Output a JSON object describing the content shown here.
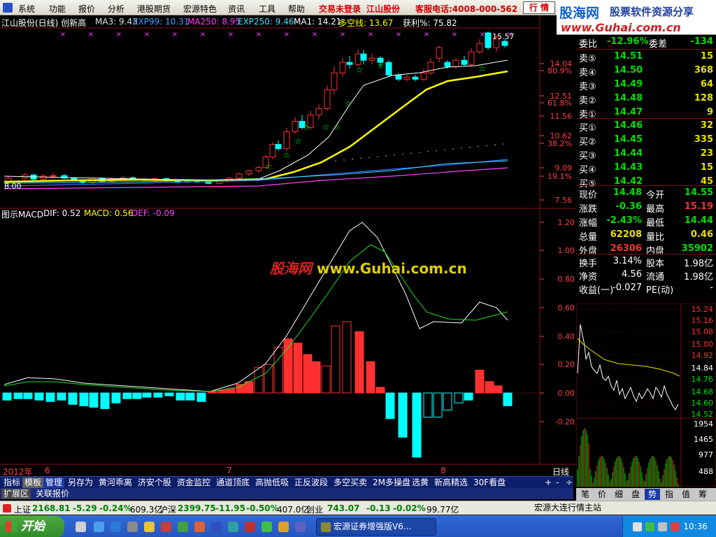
{
  "menu": {
    "items": [
      "系统",
      "功能",
      "报价",
      "分析",
      "港股期货",
      "宏源特色",
      "资讯",
      "工具",
      "帮助"
    ],
    "login_status": "交易未登录",
    "stock_name": "江山股份",
    "hotline": "客服电话:4008-000-562",
    "quote_btn": "行 情"
  },
  "logo": {
    "brand": "股海网",
    "slogan": "股票软件资源分享",
    "url": "www.Guhai.com.cn"
  },
  "kline_info": {
    "title": "江山股份(日线) 创新高",
    "ma3": "MA3: 9.43",
    "exp99": "EXP99: 10.31",
    "ma250": "MA250: 8.95",
    "exp250": "EXP250: 9.46",
    "ma1": "MA1: 14.21",
    "dkx": "多空线: 13.67",
    "profit": "获利%: 75.82"
  },
  "price_axis": [
    "14.04",
    "80.9%",
    "12.51",
    "61.8%",
    "11.56",
    "10.62",
    "38.2%",
    "9.09",
    "19.1%",
    "7.56"
  ],
  "kline_labels": {
    "high_mark": "15.57",
    "low_mark": "8.00"
  },
  "macd_info": {
    "title": "图示MACD",
    "dif": "DIF: 0.52",
    "macd": "MACD: 0.56",
    "def": "DEF: -0.09"
  },
  "macd_axis": [
    "1.20",
    "1.00",
    "0.80",
    "0.60",
    "0.40",
    "0.20",
    "0.00",
    "-0.20"
  ],
  "watermark": {
    "cn": "股海网",
    "url": "www.Guhai.com.cn"
  },
  "period_bar": {
    "year": "2012年",
    "m6": "6",
    "m7": "7",
    "m8": "8",
    "cycle": "日线"
  },
  "tabs1": [
    "指标",
    "模板",
    "管理",
    "另存为",
    "黄河乖离",
    "济安个股",
    "资金监控",
    "通道顶底",
    "高抛低吸",
    "正反波段",
    "多空买卖",
    "2M多操盘",
    "选黄",
    "新高精选",
    "30F看盘"
  ],
  "tabs2": [
    "扩展区",
    "关联报价"
  ],
  "zoom": [
    "+",
    "-",
    "÷"
  ],
  "right_tabs": [
    "笔",
    "价",
    "细",
    "盘",
    "势",
    "指",
    "值",
    "筹"
  ],
  "order_book": {
    "wb_label": "委比",
    "wb": "-12.96%",
    "wc_label": "委差",
    "wc": "-134",
    "asks": [
      {
        "label": "卖⑤",
        "price": "14.51",
        "vol": "15"
      },
      {
        "label": "卖④",
        "price": "14.50",
        "vol": "368"
      },
      {
        "label": "卖③",
        "price": "14.49",
        "vol": "64"
      },
      {
        "label": "卖②",
        "price": "14.48",
        "vol": "128"
      },
      {
        "label": "卖①",
        "price": "14.47",
        "vol": "9"
      }
    ],
    "bids": [
      {
        "label": "买①",
        "price": "14.46",
        "vol": "32"
      },
      {
        "label": "买②",
        "price": "14.45",
        "vol": "335"
      },
      {
        "label": "买③",
        "price": "14.44",
        "vol": "23"
      },
      {
        "label": "买④",
        "price": "14.43",
        "vol": "15"
      },
      {
        "label": "买⑤",
        "price": "14.42",
        "vol": "45"
      }
    ]
  },
  "quote": [
    {
      "l1": "现价",
      "v1": "14.48",
      "l2": "今开",
      "v2": "14.55",
      "c1": "#00e000",
      "c2": "#00e000"
    },
    {
      "l1": "涨跌",
      "v1": "-0.36",
      "l2": "最高",
      "v2": "15.19",
      "c1": "#00e000",
      "c2": "#ff3030"
    },
    {
      "l1": "涨幅",
      "v1": "-2.43%",
      "l2": "最低",
      "v2": "14.44",
      "c1": "#00e000",
      "c2": "#00e000"
    },
    {
      "l1": "总量",
      "v1": "62208",
      "l2": "量比",
      "v2": "0.46",
      "c1": "#e8e000",
      "c2": "#e8e000"
    },
    {
      "l1": "外盘",
      "v1": "26306",
      "l2": "内盘",
      "v2": "35902",
      "c1": "#ff3030",
      "c2": "#00e000"
    }
  ],
  "fund": [
    {
      "l1": "换手",
      "v1": "3.14%",
      "l2": "股本",
      "v2": "1.98亿"
    },
    {
      "l1": "净资",
      "v1": "4.56",
      "l2": "流通",
      "v2": "1.98亿"
    },
    {
      "l1": "收益(一)",
      "v1": "-0.027",
      "l2": "PE(动)",
      "v2": "-"
    }
  ],
  "intraday_axis": [
    "15.24",
    "15.16",
    "15.08",
    "15.00",
    "14.92",
    "14.84",
    "14.76",
    "14.68",
    "14.60",
    "14.52"
  ],
  "volume_axis": [
    "1954",
    "1465",
    "977",
    "488"
  ],
  "status": {
    "sh_label": "上证",
    "sh": "2168.81",
    "sh_chg": "-5.29",
    "sh_pct": "-0.24%",
    "sh_amt": "609.3亿",
    "sz_label": "沪深",
    "sz": "2399.75",
    "sz_chg": "-11.95",
    "sz_pct": "-0.50%",
    "sz_amt": "407.0亿",
    "cy_label": "创业",
    "cy": "743.07",
    "cy_chg": "-0.13",
    "cy_pct": "-0.02%",
    "cy_amt": "99.77亿",
    "server": "宏源大连行情主站"
  },
  "taskbar": {
    "start": "开始",
    "task": "宏源证券增强版V6...",
    "time": "10:36"
  },
  "colors": {
    "up": "#ff3030",
    "down": "#00ffff",
    "grid": "#8a1010",
    "axis": "#ff4040"
  }
}
